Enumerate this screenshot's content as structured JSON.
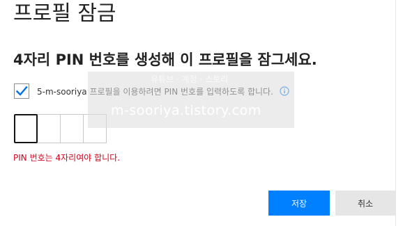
{
  "page": {
    "title": "프로필 잠금",
    "subtitle": "4자리 PIN 번호를 생성해 이 프로필을 잠그세요."
  },
  "checkbox": {
    "checked": true,
    "label": "5-m-sooriya 프로필을 이용하려면 PIN 번호를 입력하도록 합니다.",
    "icon": "info-icon"
  },
  "watermark": {
    "subtext": "유튜브 · 계정 · 스토리",
    "url": "m-sooriya.tistory.com"
  },
  "pin": {
    "digits": [
      "",
      "",
      "",
      ""
    ],
    "active_index": 0
  },
  "error": {
    "message": "PIN 번호는 4자리여야 합니다."
  },
  "buttons": {
    "save_label": "저장",
    "cancel_label": "취소"
  },
  "colors": {
    "primary": "#0080ff",
    "error": "#d0021b",
    "check": "#0071eb"
  }
}
